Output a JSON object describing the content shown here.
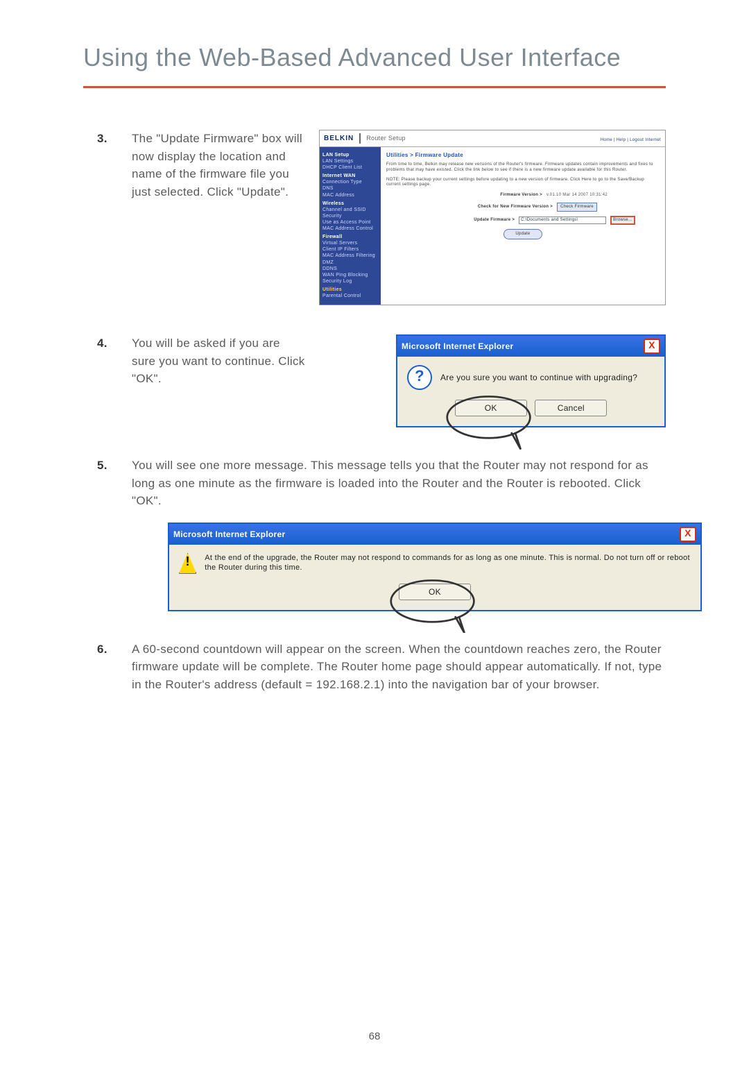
{
  "title": "Using the Web-Based Advanced User Interface",
  "page_number": "68",
  "step3": {
    "num": "3.",
    "text": "The \"Update Firmware\" box will now display the location and name of the firmware file you just selected. Click \"Update\".",
    "router": {
      "brand": "BELKIN",
      "page": "Router Setup",
      "topright": "Home | Help | Logout   Internet",
      "sidebar": {
        "lan_h": "LAN Setup",
        "lan1": "LAN Settings",
        "lan2": "DHCP Client List",
        "wan_h": "Internet WAN",
        "wan1": "Connection Type",
        "wan2": "DNS",
        "wan3": "MAC Address",
        "wl_h": "Wireless",
        "wl1": "Channel and SSID",
        "wl2": "Security",
        "wl3": "Use as Access Point",
        "wl4": "MAC Address Control",
        "fw_h": "Firewall",
        "fw1": "Virtual Servers",
        "fw2": "Client IP Filters",
        "fw3": "MAC Address Filtering",
        "fw4": "DMZ",
        "fw5": "DDNS",
        "fw6": "WAN Ping Blocking",
        "fw7": "Security Log",
        "ut_h": "Utilities",
        "ut1": "Parental Control"
      },
      "main": {
        "header": "Utilities > Firmware Update",
        "p1": "From time to time, Belkin may release new versions of the Router's firmware. Firmware updates contain improvements and fixes to problems that may have existed. Click the link below to see if there is a new firmware update available for this Router.",
        "p2": "NOTE: Please backup your current settings before updating to a new version of firmware. Click Here to go to the Save/Backup current settings page.",
        "fv_lbl": "Firmware Version >",
        "fv_val": "v.01.10 Mar 14 2007 10:31:42",
        "chk_lbl": "Check for New Firmware Version >",
        "chk_btn": "Check Firmware",
        "uf_lbl": "Update Firmware >",
        "uf_path": "C:\\Documents and Settings\\",
        "uf_browse": "Browse...",
        "update_btn": "Update"
      }
    }
  },
  "step4": {
    "num": "4.",
    "text": "You will be asked if you are sure you want to continue. Click \"OK\".",
    "dialog": {
      "title": "Microsoft Internet Explorer",
      "close": "X",
      "icon": "?",
      "msg": "Are you sure you want to continue with upgrading?",
      "ok": "OK",
      "cancel": "Cancel"
    }
  },
  "step5": {
    "num": "5.",
    "text": "You will see one more message. This message tells you that the Router may not respond for as long as one minute as the firmware is loaded into the Router and the Router is rebooted. Click \"OK\".",
    "dialog": {
      "title": "Microsoft Internet Explorer",
      "close": "X",
      "icon": "!",
      "msg": "At the end of the upgrade, the Router may not respond to commands for as long as one minute. This is normal. Do not turn off or reboot the Router during this time.",
      "ok": "OK"
    }
  },
  "step6": {
    "num": "6.",
    "text": "A 60-second countdown will appear on the screen. When the countdown reaches zero, the Router firmware update will be complete. The Router home page should appear automatically. If not, type in the Router's address (default = 192.168.2.1) into the navigation bar of your browser."
  }
}
